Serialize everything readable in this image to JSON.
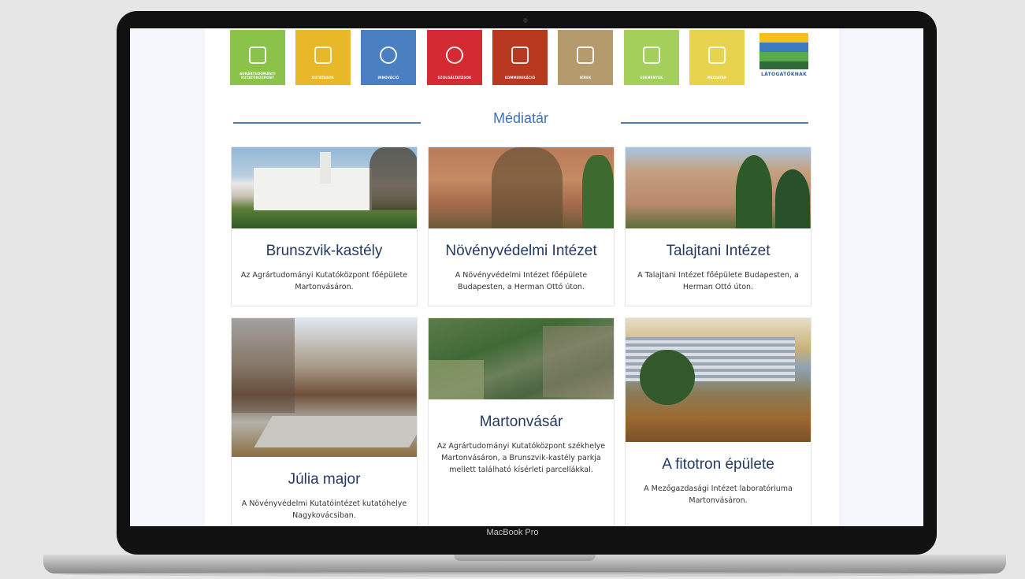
{
  "device": {
    "label": "MacBook Pro"
  },
  "nav_tiles": [
    {
      "label": "AGRÁRTUDOMÁNYI KUTATÓKÖZPONT",
      "color": "#8bc34a",
      "icon": "landscape-icon"
    },
    {
      "label": "KUTATÁSOK",
      "color": "#e9b828",
      "icon": "microscope-icon"
    },
    {
      "label": "INNOVÁCIÓ",
      "color": "#4a7fc1",
      "icon": "lightbulb-icon"
    },
    {
      "label": "SZOLGÁLTATÁSOK",
      "color": "#d42a33",
      "icon": "target-icon"
    },
    {
      "label": "KOMMUNIKÁCIÓ",
      "color": "#b8391f",
      "icon": "chat-icon"
    },
    {
      "label": "HÍREK",
      "color": "#b59a6e",
      "icon": "document-icon"
    },
    {
      "label": "ESEMÉNYEK",
      "color": "#a4cf5b",
      "icon": "calendar-icon"
    },
    {
      "label": "MÉDIATÁR",
      "color": "#e8d34f",
      "icon": "image-icon"
    }
  ],
  "logo": {
    "label": "LÁTOGATÓKNAK"
  },
  "section": {
    "title": "Médiatár"
  },
  "cards": [
    {
      "title": "Brunszvik-kastély",
      "desc": "Az Agrártudományi Kutatóközpont főépülete Martonvásáron."
    },
    {
      "title": "Növényvédelmi Intézet",
      "desc": "A Növényvédelmi Intézet főépülete Budapesten, a Herman Ottó úton."
    },
    {
      "title": "Talajtani Intézet",
      "desc": "A Talajtani Intézet főépülete Budapesten, a Herman Ottó úton."
    },
    {
      "title": "Júlia major",
      "desc": "A Növényvédelmi Kutatóintézet kutatóhelye Nagykovácsiban."
    },
    {
      "title": "Martonvásár",
      "desc": "Az Agrártudományi Kutatóközpont székhelye Martonvásáron, a Brunszvik-kastély parkja mellett található kísérleti parcellákkal."
    },
    {
      "title": "A fitotron épülete",
      "desc": "A Mezőgazdasági Intézet laboratóriuma Martonvásáron."
    }
  ]
}
